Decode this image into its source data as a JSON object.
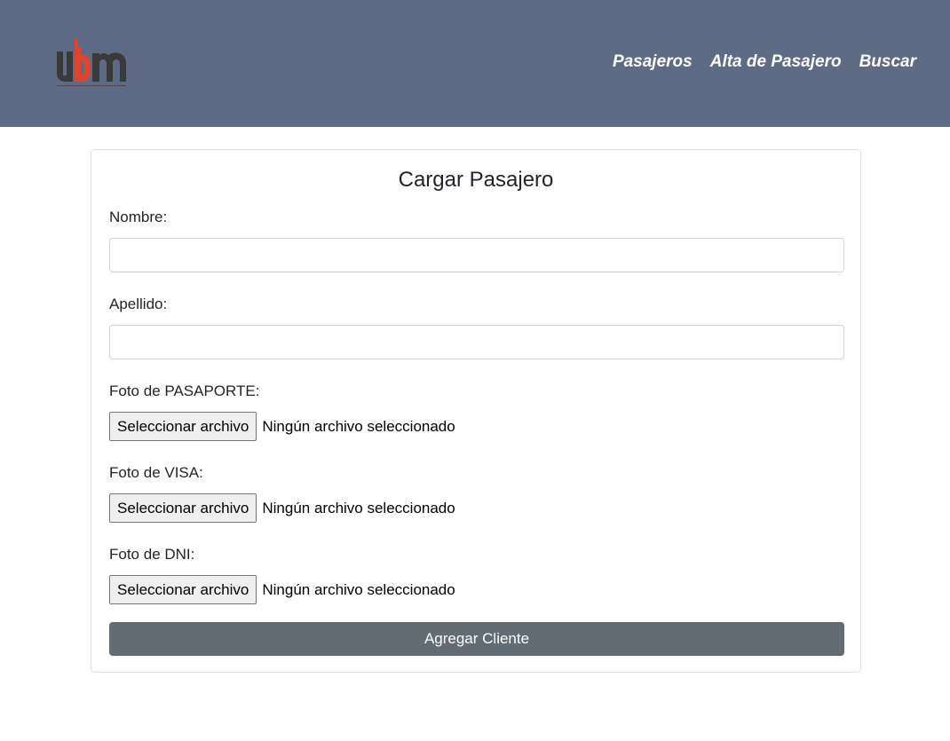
{
  "brand": {
    "logo_text": "ubm",
    "logo_subtext": "UNIT TRAINING"
  },
  "nav": {
    "links": [
      {
        "label": "Pasajeros"
      },
      {
        "label": "Alta de Pasajero"
      },
      {
        "label": "Buscar"
      }
    ]
  },
  "form": {
    "title": "Cargar Pasajero",
    "nombre": {
      "label": "Nombre:",
      "value": "",
      "placeholder": ""
    },
    "apellido": {
      "label": "Apellido:",
      "value": "",
      "placeholder": ""
    },
    "pasaporte": {
      "label": "Foto de PASAPORTE:",
      "button": "Seleccionar archivo",
      "status": "Ningún archivo seleccionado"
    },
    "visa": {
      "label": "Foto de VISA:",
      "button": "Seleccionar archivo",
      "status": "Ningún archivo seleccionado"
    },
    "dni": {
      "label": "Foto de DNI:",
      "button": "Seleccionar archivo",
      "status": "Ningún archivo seleccionado"
    },
    "submit_label": "Agregar Cliente"
  },
  "colors": {
    "navbar_bg": "#5f6a85",
    "logo_accent": "#e0442c",
    "logo_dark": "#3a3a3a",
    "submit_bg": "#636b73"
  }
}
